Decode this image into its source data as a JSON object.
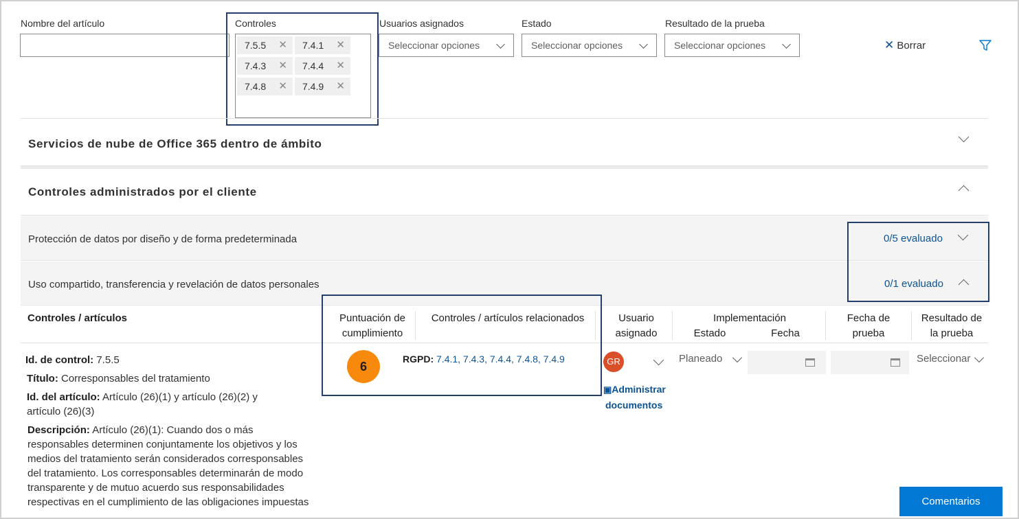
{
  "filters": {
    "article_name_label": "Nombre del artículo",
    "controls_label": "Controles",
    "users_label": "Usuarios asignados",
    "users_placeholder": "Seleccionar opciones",
    "status_label": "Estado",
    "status_placeholder": "Seleccionar opciones",
    "test_label": "Resultado de la prueba",
    "test_placeholder": "Seleccionar opciones",
    "clear_label": "Borrar",
    "chips": [
      "7.5.5",
      "7.4.1",
      "7.4.3",
      "7.4.4",
      "7.4.8",
      "7.4.9"
    ]
  },
  "sections": {
    "office_title": "Servicios de nube de Office 365 dentro de ámbito",
    "customer_title": "Controles administrados por el cliente",
    "group1_title": "Protección de datos por diseño y de forma predeterminada",
    "group1_status": "0/5 evaluado",
    "group2_title": "Uso compartido, transferencia y revelación de datos personales",
    "group2_status": "0/1 evaluado"
  },
  "table": {
    "col_controls": "Controles / artículos",
    "col_score_1": "Puntuación de",
    "col_score_2": "cumplimiento",
    "col_related": "Controles / artículos relacionados",
    "col_user_1": "Usuario",
    "col_user_2": "asignado",
    "col_impl": "Implementación",
    "col_impl_status": "Estado",
    "col_impl_date": "Fecha",
    "col_test_date_1": "Fecha de",
    "col_test_date_2": "prueba",
    "col_result_1": "Resultado de",
    "col_result_2": "la prueba"
  },
  "row": {
    "control_id_label": "Id. de control:",
    "control_id": "7.5.5",
    "title_label": "Título:",
    "title": "Corresponsables del tratamiento",
    "article_id_label": "Id. del artículo:",
    "article_id_1": "Artículo (26)(1) y artículo (26)(2) y",
    "article_id_2": "artículo (26)(3)",
    "description_label": "Descripción:",
    "description_lines": [
      " Artículo (26)(1): Cuando dos o más",
      "responsables determinen conjuntamente los objetivos y los",
      "medios del tratamiento serán considerados corresponsables",
      "del tratamiento. Los corresponsables determinarán de modo",
      "transparente y de mutuo acuerdo sus responsabilidades",
      "respectivas en el cumplimiento de las obligaciones impuestas"
    ],
    "score": "6",
    "related_prefix": "RGPD:",
    "related_links": "7.4.1, 7.4.3, 7.4.4, 7.4.8, 7.4.9",
    "user_initials": "GR",
    "manage_docs_1": "Administrar",
    "manage_docs_2": "documentos",
    "impl_status": "Planeado",
    "result_value": "Seleccionar"
  },
  "feedback_button": "Comentarios",
  "colors": {
    "accent": "#0078d4",
    "link": "#0b5394",
    "callout": "#243f6b",
    "score_badge": "#f7890c",
    "avatar": "#d84f2a"
  }
}
